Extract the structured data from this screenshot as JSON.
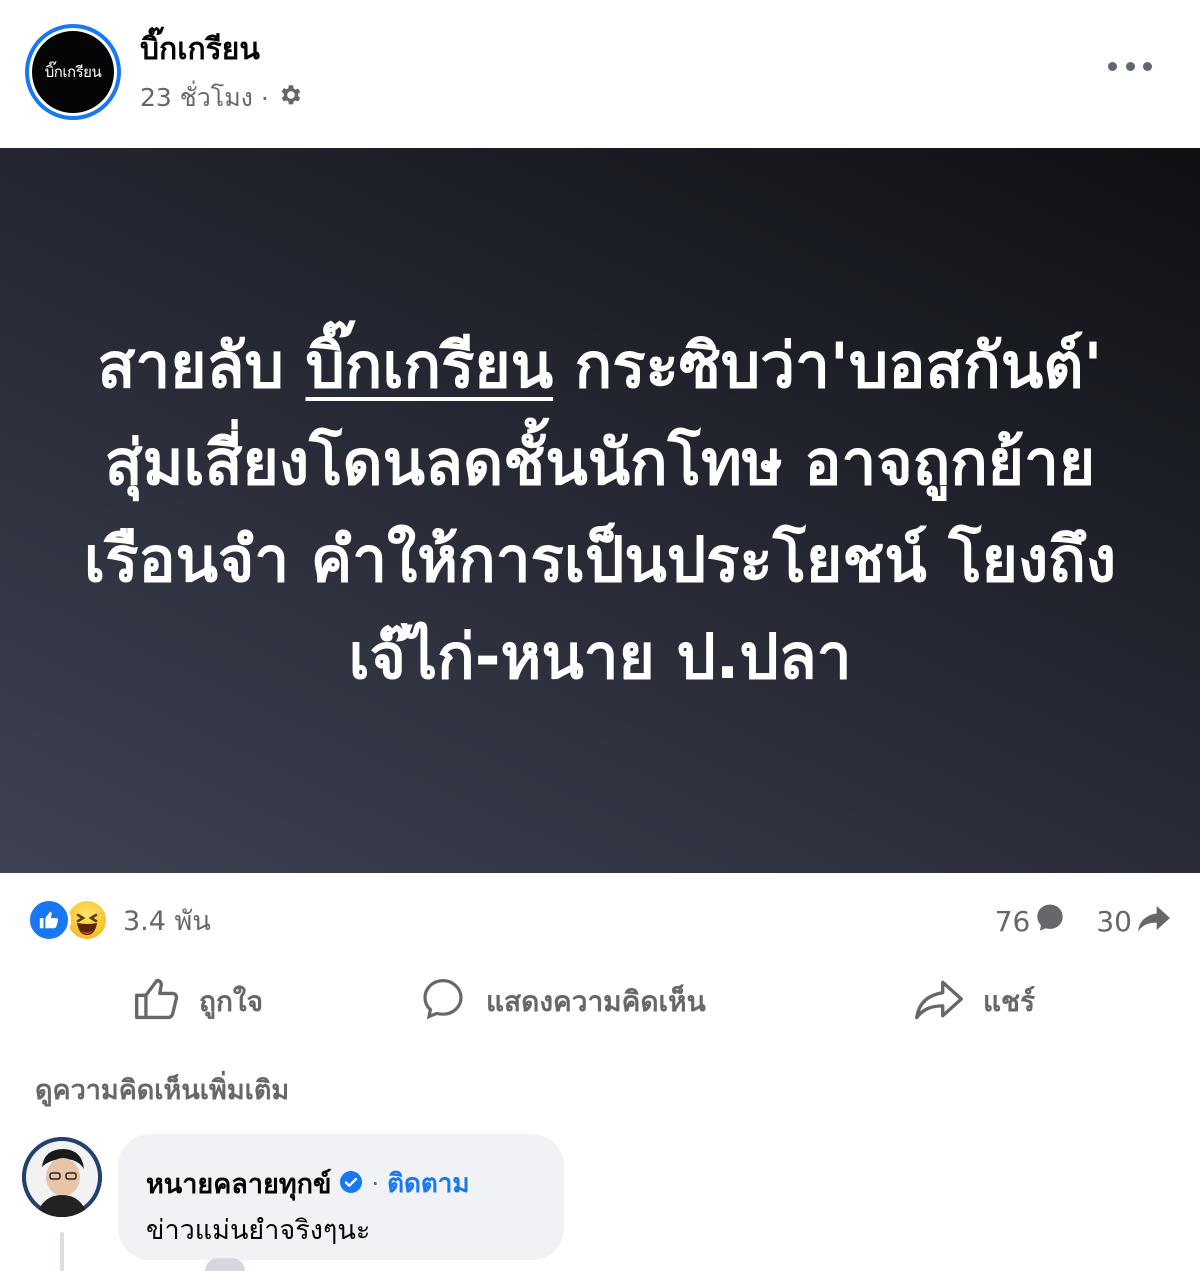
{
  "post": {
    "page_name": "บิ๊กเกรียน",
    "avatar_text": "บิ๊กเกรียน",
    "time": "23 ชั่วโมง",
    "separator": "·",
    "audience_icon": "gear-icon",
    "more_icon": "ellipsis-icon"
  },
  "headline": {
    "before": "สายลับ ",
    "underlined": "บิ๊กเกรียน",
    "after": " กระซิบว่า'บอสกันต์' สุ่มเสี่ยงโดนลดชั้นนักโทษ อาจถูกย้ายเรือนจำ คำให้การเป็นประโยชน์ โยงถึงเจ๊ไก่-หนาย ป.ปลา"
  },
  "stats": {
    "reactions_count": "3.4 พัน",
    "reaction_icons": [
      "like-icon",
      "haha-icon"
    ],
    "comments_count": "76",
    "shares_count": "30"
  },
  "actions": {
    "like": "ถูกใจ",
    "comment": "แสดงความคิดเห็น",
    "share": "แชร์"
  },
  "comments": {
    "view_more": "ดูความคิดเห็นเพิ่มเติม",
    "items": [
      {
        "author": "หนายคลายทุกข์",
        "verified": true,
        "separator": "·",
        "follow": "ติดตาม",
        "text": "ข่าวแม่นยำจริงๆนะ"
      }
    ]
  },
  "colors": {
    "accent": "#1877f2",
    "secondary_text": "#65676b",
    "bubble": "#f0f2f5"
  }
}
